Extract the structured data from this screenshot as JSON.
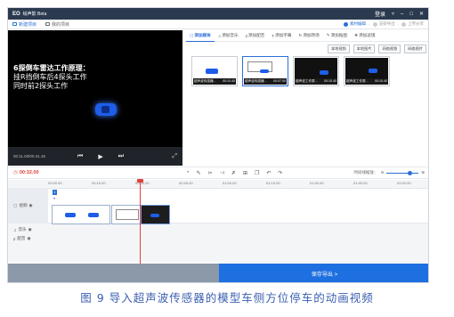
{
  "titlebar": {
    "logo": "EO",
    "title": "绘声影 Beta",
    "login": "登录"
  },
  "projbar": {
    "new_project": "新建项目",
    "my_projects": "我的项目"
  },
  "steps": [
    {
      "label": "素材编辑",
      "active": true
    },
    {
      "label": "渲染导出",
      "active": false
    },
    {
      "label": "上传分享",
      "active": false
    }
  ],
  "preview": {
    "line1": "6探倒车雷达工作原理：",
    "line2": "挂R挡倒车后4探头工作",
    "line3": "同时前2探头工作",
    "time": "00:11.00/00:41.45"
  },
  "tabs": [
    {
      "label": "添加媒体",
      "icon": "media-icon",
      "active": true
    },
    {
      "label": "添加音乐",
      "icon": "music-icon",
      "active": false
    },
    {
      "label": "添加配音",
      "icon": "dub-icon",
      "active": false
    },
    {
      "label": "添加字幕",
      "icon": "subtitle-icon",
      "active": false
    },
    {
      "label": "添加转场",
      "icon": "transition-icon",
      "active": false
    },
    {
      "label": "添加贴图",
      "icon": "sticker-icon",
      "active": false
    },
    {
      "label": "添加滤镜",
      "icon": "filter-icon",
      "active": false
    }
  ],
  "import_buttons": [
    "本地视频",
    "本地图片",
    "网络视频",
    "网络图片"
  ],
  "thumbnails": [
    {
      "name": "超声波传感器...",
      "duration": "00:10.40",
      "style": "light"
    },
    {
      "name": "超声波传感器...",
      "duration": "00:07.00",
      "style": "light"
    },
    {
      "name": "超声波工作原...",
      "duration": "00:10.40",
      "style": "dark"
    },
    {
      "name": "超声波工作原...",
      "duration": "00:10.40",
      "style": "dark"
    }
  ],
  "editbar": {
    "current_time": "00:32.00",
    "zoom_label": "时间线缩放："
  },
  "ruler": [
    "00:00.00",
    "00:15.00",
    "00:30.00",
    "00:45.00",
    "01:00.00",
    "01:15.00",
    "01:30.00",
    "01:45.00",
    "02:00.00"
  ],
  "tracks": {
    "video": "视频",
    "music": "音乐",
    "dub": "配音",
    "marker": "1"
  },
  "footer": {
    "export": "保存导出 >"
  },
  "caption": "图 9  导入超声波传感器的模型车侧方位停车的动画视频",
  "colors": {
    "accent": "#1e6fe0",
    "playhead": "#e0403a",
    "titlebar": "#2b3a4f"
  }
}
